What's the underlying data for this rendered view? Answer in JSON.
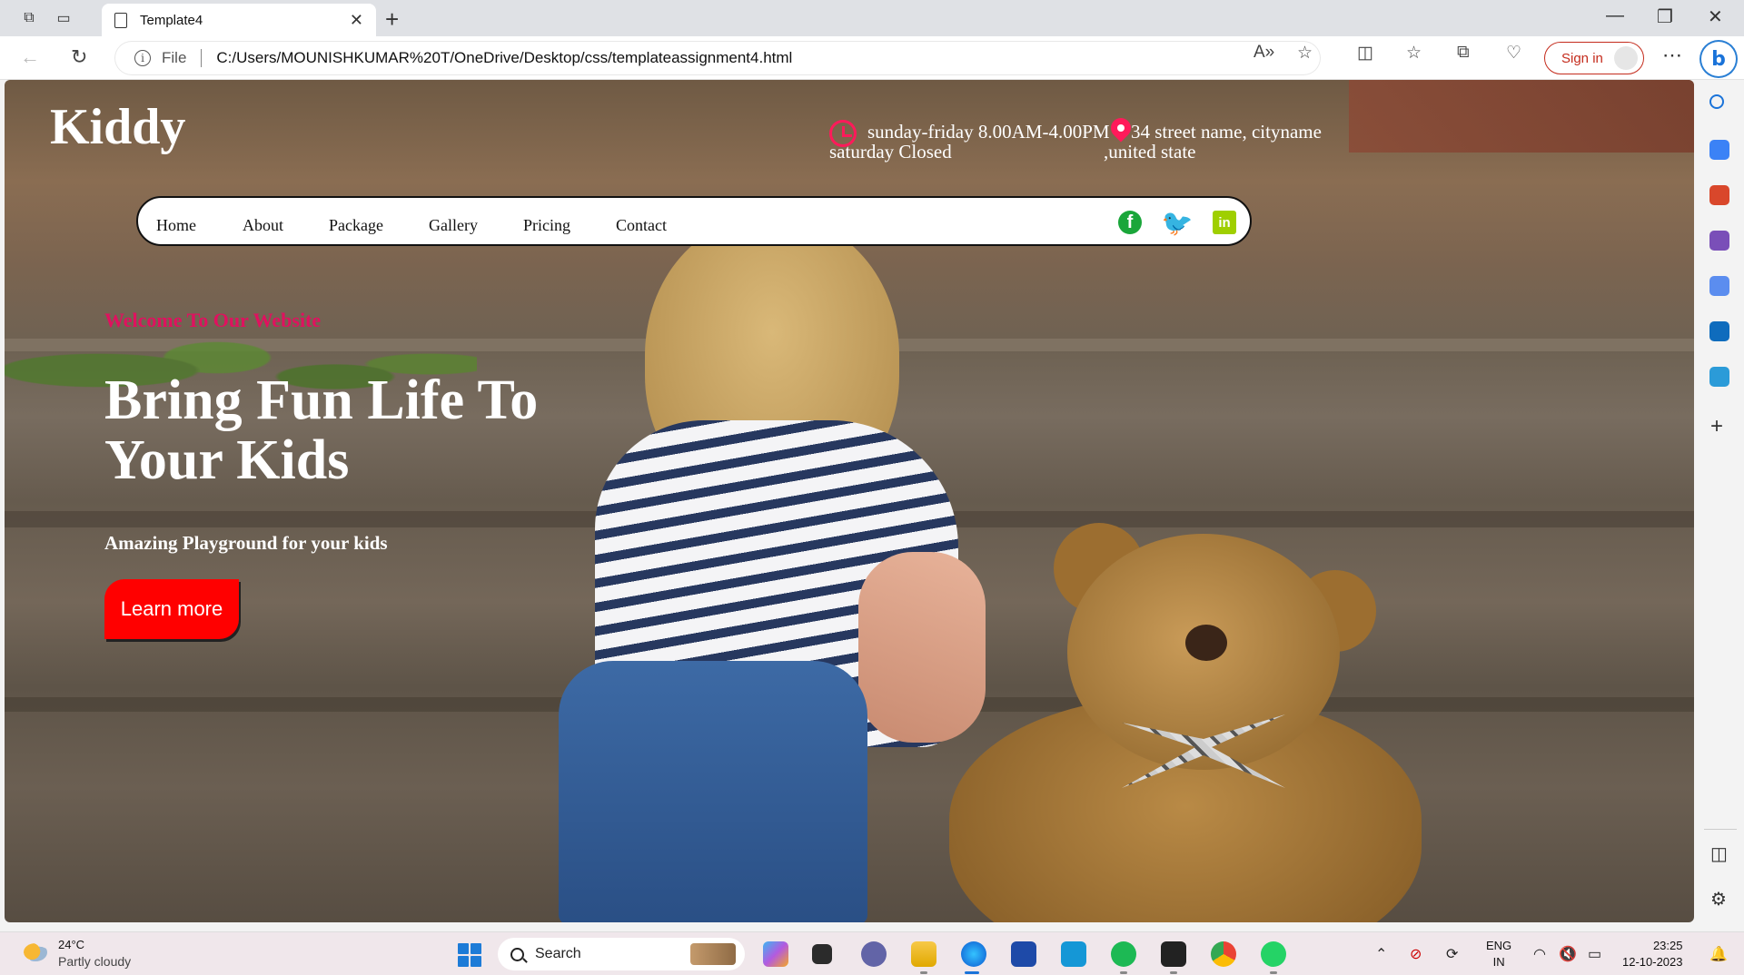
{
  "browser": {
    "tab_title": "Template4",
    "url_scheme_label": "File",
    "url": "C:/Users/MOUNISHKUMAR%20T/OneDrive/Desktop/css/templateassignment4.html",
    "signin_label": "Sign in"
  },
  "site": {
    "brand": "Kiddy",
    "hours_line1": "sunday-friday 8.00AM-4.00PM",
    "hours_line2": "saturday Closed",
    "address_line1": "34 street name, cityname",
    "address_line2": ",united state",
    "nav": [
      "Home",
      "About",
      "Package",
      "Gallery",
      "Pricing",
      "Contact"
    ],
    "social": [
      "facebook-icon",
      "twitter-icon",
      "linkedin-icon"
    ],
    "welcome": "Welcome To Our Website",
    "headline": "Bring Fun Life To Your Kids",
    "tagline": "Amazing Playground for your kids",
    "cta": "Learn more",
    "colors": {
      "accent": "#e0115f",
      "cta": "#ff0000",
      "social": "#1aa63a"
    }
  },
  "taskbar": {
    "weather_temp": "24°C",
    "weather_desc": "Partly cloudy",
    "search_label": "Search",
    "lang_line1": "ENG",
    "lang_line2": "IN",
    "time": "23:25",
    "date": "12-10-2023"
  }
}
